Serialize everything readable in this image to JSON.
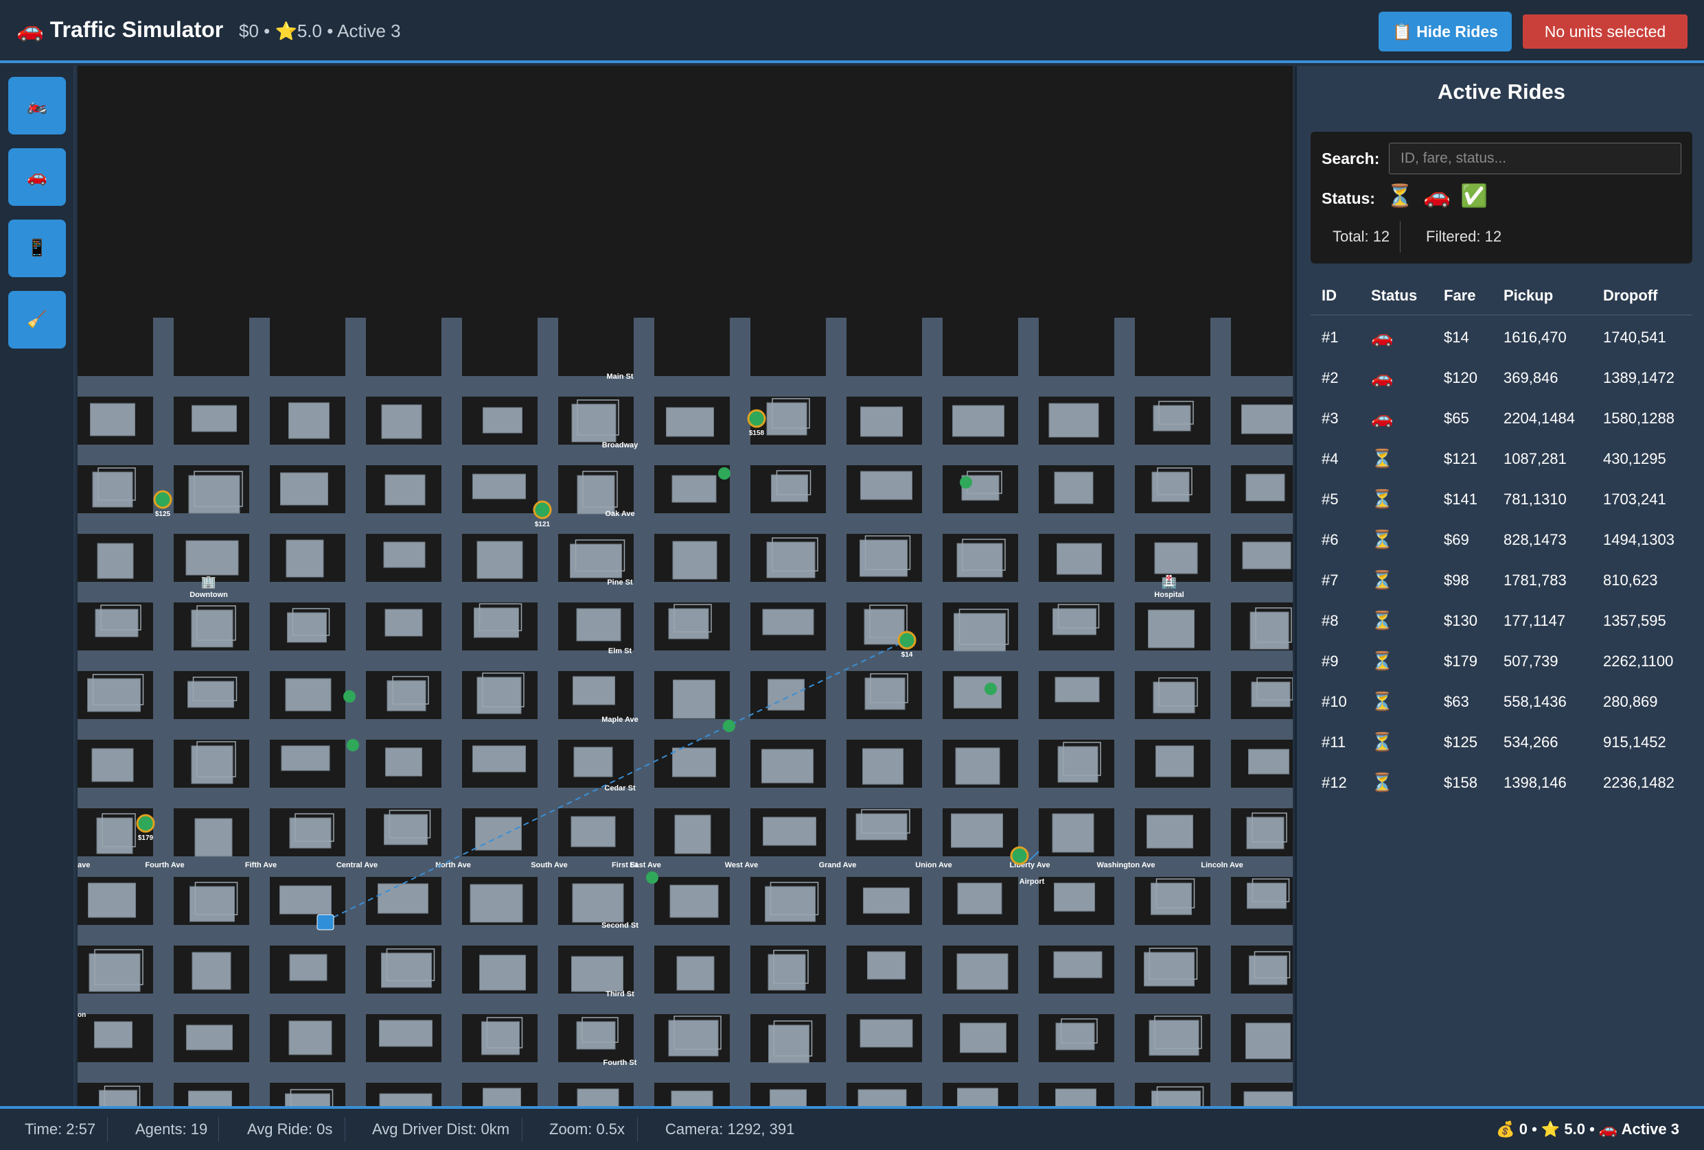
{
  "header": {
    "title": "🚗 Traffic Simulator",
    "stats": "$0 • ⭐5.0 • Active 3",
    "hide_rides_label": "📋 Hide Rides",
    "units_label": "No units selected"
  },
  "toolbar": {
    "items": [
      {
        "name": "motorcycle-icon",
        "glyph": "🏍️"
      },
      {
        "name": "car-icon",
        "glyph": "🚗"
      },
      {
        "name": "phone-icon",
        "glyph": "📱"
      },
      {
        "name": "broom-icon",
        "glyph": "🧹"
      }
    ]
  },
  "map": {
    "horizontal_streets": [
      "Main St",
      "Broadway",
      "Oak Ave",
      "Pine St",
      "Elm St",
      "Maple Ave",
      "Cedar St",
      "Second St",
      "Third St",
      "Fourth St"
    ],
    "vertical_streets": [
      "ave",
      "Fourth Ave",
      "Fifth Ave",
      "Central Ave",
      "North Ave",
      "South Ave",
      "First St",
      "East Ave",
      "West Ave",
      "Grand Ave",
      "Union Ave",
      "Liberty Ave",
      "Washington Ave",
      "Lincoln Ave"
    ],
    "landmarks": [
      {
        "name": "Downtown",
        "icon": "🏢"
      },
      {
        "name": "Hospital",
        "icon": "🏥"
      },
      {
        "name": "Airport",
        "icon": ""
      }
    ],
    "fare_markers": [
      "$158",
      "$125",
      "$121",
      "$14",
      "$179"
    ],
    "edge_label": "on"
  },
  "panel": {
    "title": "Active Rides",
    "search_label": "Search:",
    "search_placeholder": "ID, fare, status...",
    "status_label": "Status:",
    "status_filters": [
      "⏳",
      "🚗",
      "✅"
    ],
    "total_label": "Total: 12",
    "filtered_label": "Filtered: 12",
    "columns": [
      "ID",
      "Status",
      "Fare",
      "Pickup",
      "Dropoff"
    ],
    "rides": [
      {
        "id": "#1",
        "status": "🚗",
        "fare": "$14",
        "pickup": "1616,470",
        "dropoff": "1740,541"
      },
      {
        "id": "#2",
        "status": "🚗",
        "fare": "$120",
        "pickup": "369,846",
        "dropoff": "1389,1472"
      },
      {
        "id": "#3",
        "status": "🚗",
        "fare": "$65",
        "pickup": "2204,1484",
        "dropoff": "1580,1288"
      },
      {
        "id": "#4",
        "status": "⏳",
        "fare": "$121",
        "pickup": "1087,281",
        "dropoff": "430,1295"
      },
      {
        "id": "#5",
        "status": "⏳",
        "fare": "$141",
        "pickup": "781,1310",
        "dropoff": "1703,241"
      },
      {
        "id": "#6",
        "status": "⏳",
        "fare": "$69",
        "pickup": "828,1473",
        "dropoff": "1494,1303"
      },
      {
        "id": "#7",
        "status": "⏳",
        "fare": "$98",
        "pickup": "1781,783",
        "dropoff": "810,623"
      },
      {
        "id": "#8",
        "status": "⏳",
        "fare": "$130",
        "pickup": "177,1147",
        "dropoff": "1357,595"
      },
      {
        "id": "#9",
        "status": "⏳",
        "fare": "$179",
        "pickup": "507,739",
        "dropoff": "2262,1100"
      },
      {
        "id": "#10",
        "status": "⏳",
        "fare": "$63",
        "pickup": "558,1436",
        "dropoff": "280,869"
      },
      {
        "id": "#11",
        "status": "⏳",
        "fare": "$125",
        "pickup": "534,266",
        "dropoff": "915,1452"
      },
      {
        "id": "#12",
        "status": "⏳",
        "fare": "$158",
        "pickup": "1398,146",
        "dropoff": "2236,1482"
      }
    ]
  },
  "statusbar": {
    "time": "Time: 2:57",
    "agents": "Agents: 19",
    "avg_ride": "Avg Ride: 0s",
    "avg_driver_dist": "Avg Driver Dist: 0km",
    "zoom": "Zoom: 0.5x",
    "camera": "Camera: 1292, 391",
    "summary": "💰 0 • ⭐ 5.0 • 🚗 Active 3"
  },
  "colors": {
    "accent": "#2f8fd8",
    "danger": "#c9403a",
    "road": "#4a5a6c",
    "building": "#8e9aa5",
    "marker_green": "#2fa85a",
    "marker_ring": "#e0a020"
  }
}
